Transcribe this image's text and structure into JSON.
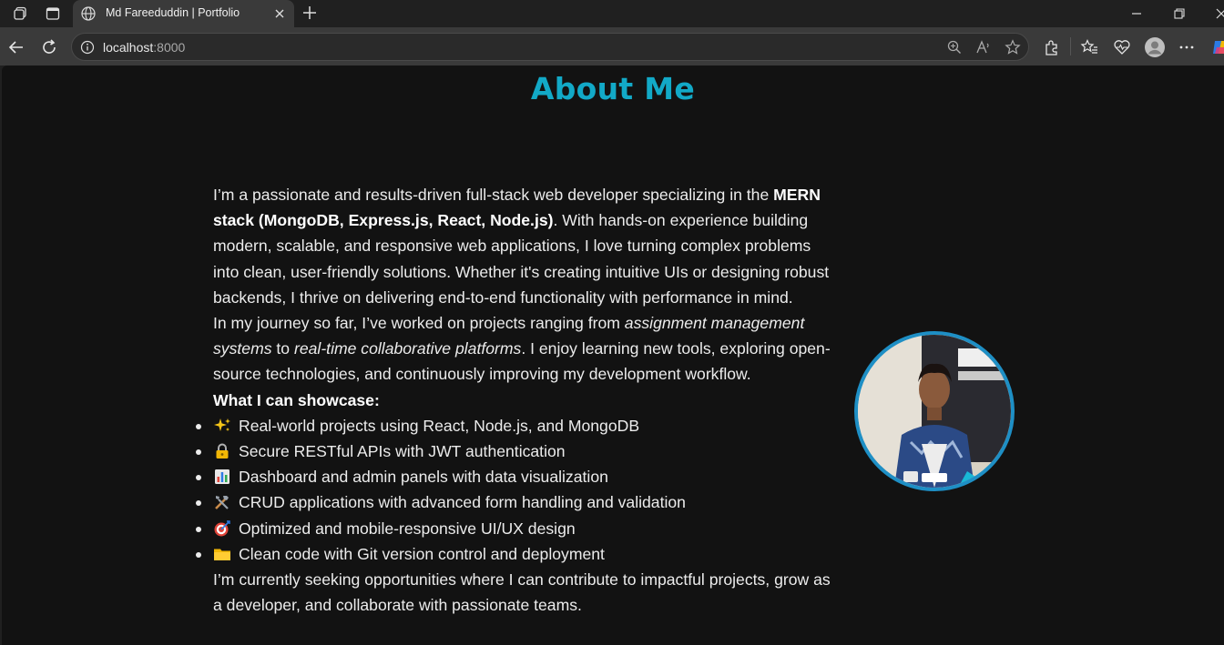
{
  "browser": {
    "tab_title": "Md Fareeduddin | Portfolio",
    "url_host": "localhost",
    "url_port": ":8000"
  },
  "page": {
    "heading": "About Me",
    "para1_a": "I’m a passionate and results-driven full-stack web developer specializing in the ",
    "para1_bold": "MERN stack (MongoDB, Express.js, React, Node.js)",
    "para1_b": ". With hands-on experience building modern, scalable, and responsive web applications, I love turning complex problems into clean, user-friendly solutions. Whether it's creating intuitive UIs or designing robust backends, I thrive on delivering end-to-end functionality with performance in mind.",
    "para2_a": "In my journey so far, I’ve worked on projects ranging from ",
    "para2_i1": "assignment management systems",
    "para2_b": " to ",
    "para2_i2": "real-time collaborative platforms",
    "para2_c": ". I enjoy learning new tools, exploring open-source technologies, and continuously improving my development workflow.",
    "showcase_title": "What I can showcase:",
    "showcase_items": [
      {
        "icon": "sparkles-icon",
        "text": "Real-world projects using React, Node.js, and MongoDB"
      },
      {
        "icon": "lock-icon",
        "text": "Secure RESTful APIs with JWT authentication"
      },
      {
        "icon": "bar-chart-icon",
        "text": "Dashboard and admin panels with data visualization"
      },
      {
        "icon": "tools-icon",
        "text": "CRUD applications with advanced form handling and validation"
      },
      {
        "icon": "target-icon",
        "text": "Optimized and mobile-responsive UI/UX design"
      },
      {
        "icon": "folder-icon",
        "text": "Clean code with Git version control and deployment"
      }
    ],
    "closing": "I’m currently seeking opportunities where I can contribute to impactful projects, grow as a developer, and collaborate with passionate teams."
  },
  "colors": {
    "accent": "#12a9c7",
    "avatar_border": "#1e8fc5",
    "page_bg": "#121212"
  }
}
